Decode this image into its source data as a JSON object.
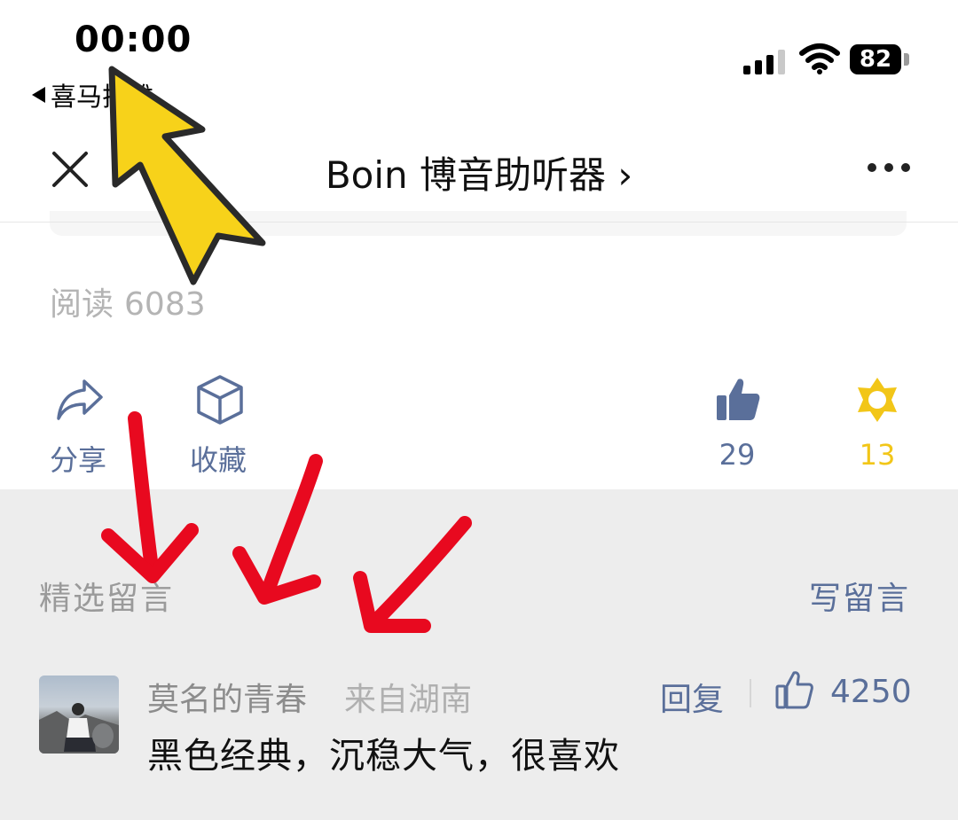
{
  "status_bar": {
    "time": "00:00",
    "back_app": "喜马拉雅",
    "battery": "82"
  },
  "nav": {
    "title": "Boin 博音助听器 ›"
  },
  "article": {
    "reads_label": "阅读",
    "reads_count": "6083"
  },
  "actions": {
    "share_label": "分享",
    "favorite_label": "收藏",
    "like_count": "29",
    "wow_count": "13"
  },
  "comments": {
    "section_title": "精选留言",
    "write_label": "写留言",
    "items": [
      {
        "user": "莫名的青春",
        "location": "来自湖南",
        "reply_label": "回复",
        "likes": "4250",
        "text": "黑色经典，沉稳大气，很喜欢"
      }
    ]
  },
  "colors": {
    "accent": "#5a6f9a",
    "wow_yellow": "#f2c618",
    "annotation_red": "#e8091f",
    "annotation_yellow": "#f7d21a"
  }
}
